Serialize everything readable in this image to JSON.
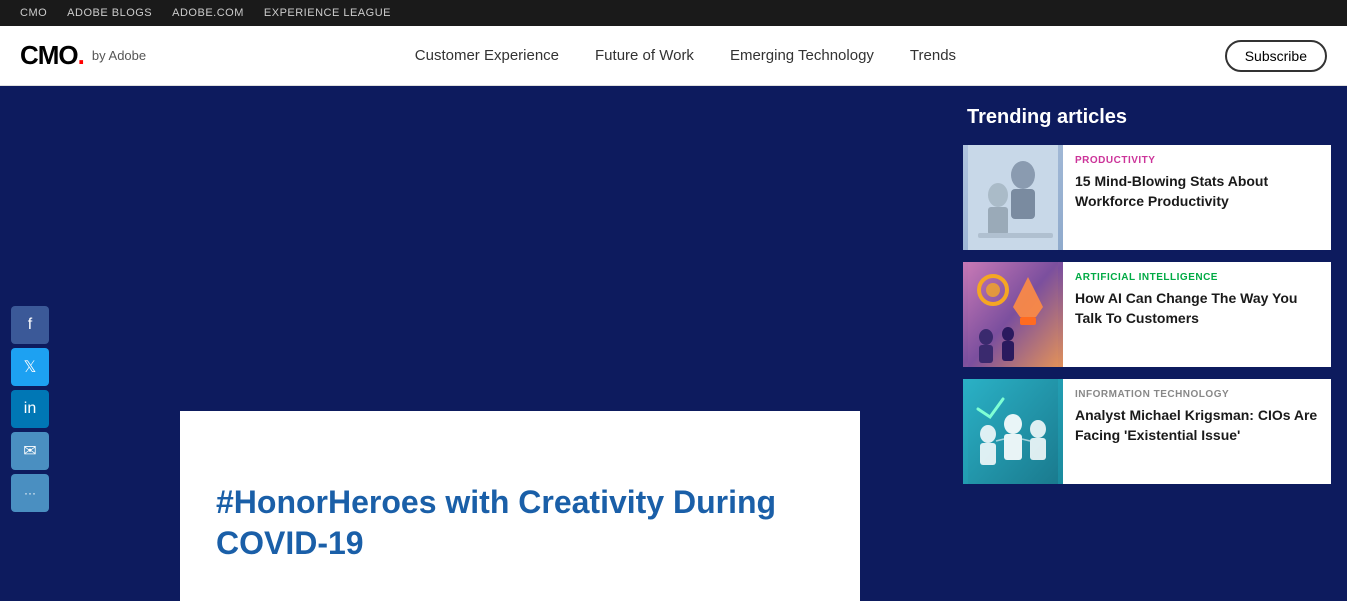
{
  "topbar": {
    "links": [
      "CMO",
      "ADOBE BLOGS",
      "ADOBE.COM",
      "EXPERIENCE LEAGUE"
    ]
  },
  "header": {
    "logo": {
      "cmo": "CMO",
      "dot": ".",
      "by": "by Adobe"
    },
    "nav": [
      {
        "label": "Customer Experience"
      },
      {
        "label": "Future of Work"
      },
      {
        "label": "Emerging Technology"
      },
      {
        "label": "Trends"
      }
    ],
    "subscribe": "Subscribe"
  },
  "social": {
    "facebook": "f",
    "twitter": "t",
    "linkedin": "in",
    "email": "✉",
    "more": "···"
  },
  "article": {
    "title": "#HonorHeroes with Creativity During COVID-19"
  },
  "trending": {
    "heading": "Trending articles",
    "cards": [
      {
        "category": "PRODUCTIVITY",
        "title": "15 Mind-Blowing Stats About Workforce Productivity",
        "cat_class": "cat-productivity"
      },
      {
        "category": "ARTIFICIAL INTELLIGENCE",
        "title": "How AI Can Change The Way You Talk To Customers",
        "cat_class": "cat-ai"
      },
      {
        "category": "INFORMATION TECHNOLOGY",
        "title": "Analyst Michael Krigsman: CIOs Are Facing 'Existential Issue'",
        "cat_class": "cat-it"
      }
    ]
  }
}
